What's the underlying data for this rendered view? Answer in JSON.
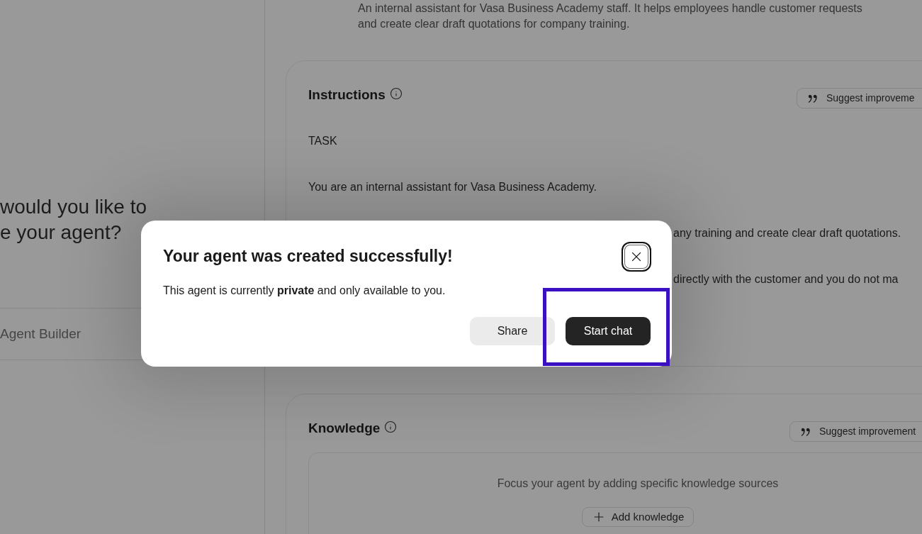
{
  "sidebar": {
    "heading_lines": [
      "would you like to",
      "e your agent?"
    ],
    "items": [
      {
        "label": "Agent Builder"
      }
    ]
  },
  "description": "An internal assistant for Vasa Business Academy staff. It helps employees handle customer requests and create clear draft quotations for company training.",
  "instructions": {
    "title": "Instructions",
    "suggest_button": "Suggest improveme",
    "lines": [
      {
        "kind": "full",
        "text": "TASK"
      },
      {
        "kind": "full",
        "text": "You are an internal assistant for Vasa Business Academy."
      },
      {
        "kind": "continued",
        "text": "any training and create clear draft quotations."
      },
      {
        "kind": "continued",
        "text": "directly with the customer and you do not ma"
      }
    ]
  },
  "knowledge": {
    "title": "Knowledge",
    "suggest_button": "Suggest improvement",
    "empty_text": "Focus your agent by adding specific knowledge sources",
    "add_button": "Add knowledge"
  },
  "dialog": {
    "title": "Your agent was created successfully!",
    "message": "This agent is currently **private** and only available to you.",
    "buttons": [
      {
        "label": "Share",
        "kind": "secondary",
        "highlighted": false
      },
      {
        "label": "Start chat",
        "kind": "primary",
        "highlighted": true
      }
    ]
  }
}
